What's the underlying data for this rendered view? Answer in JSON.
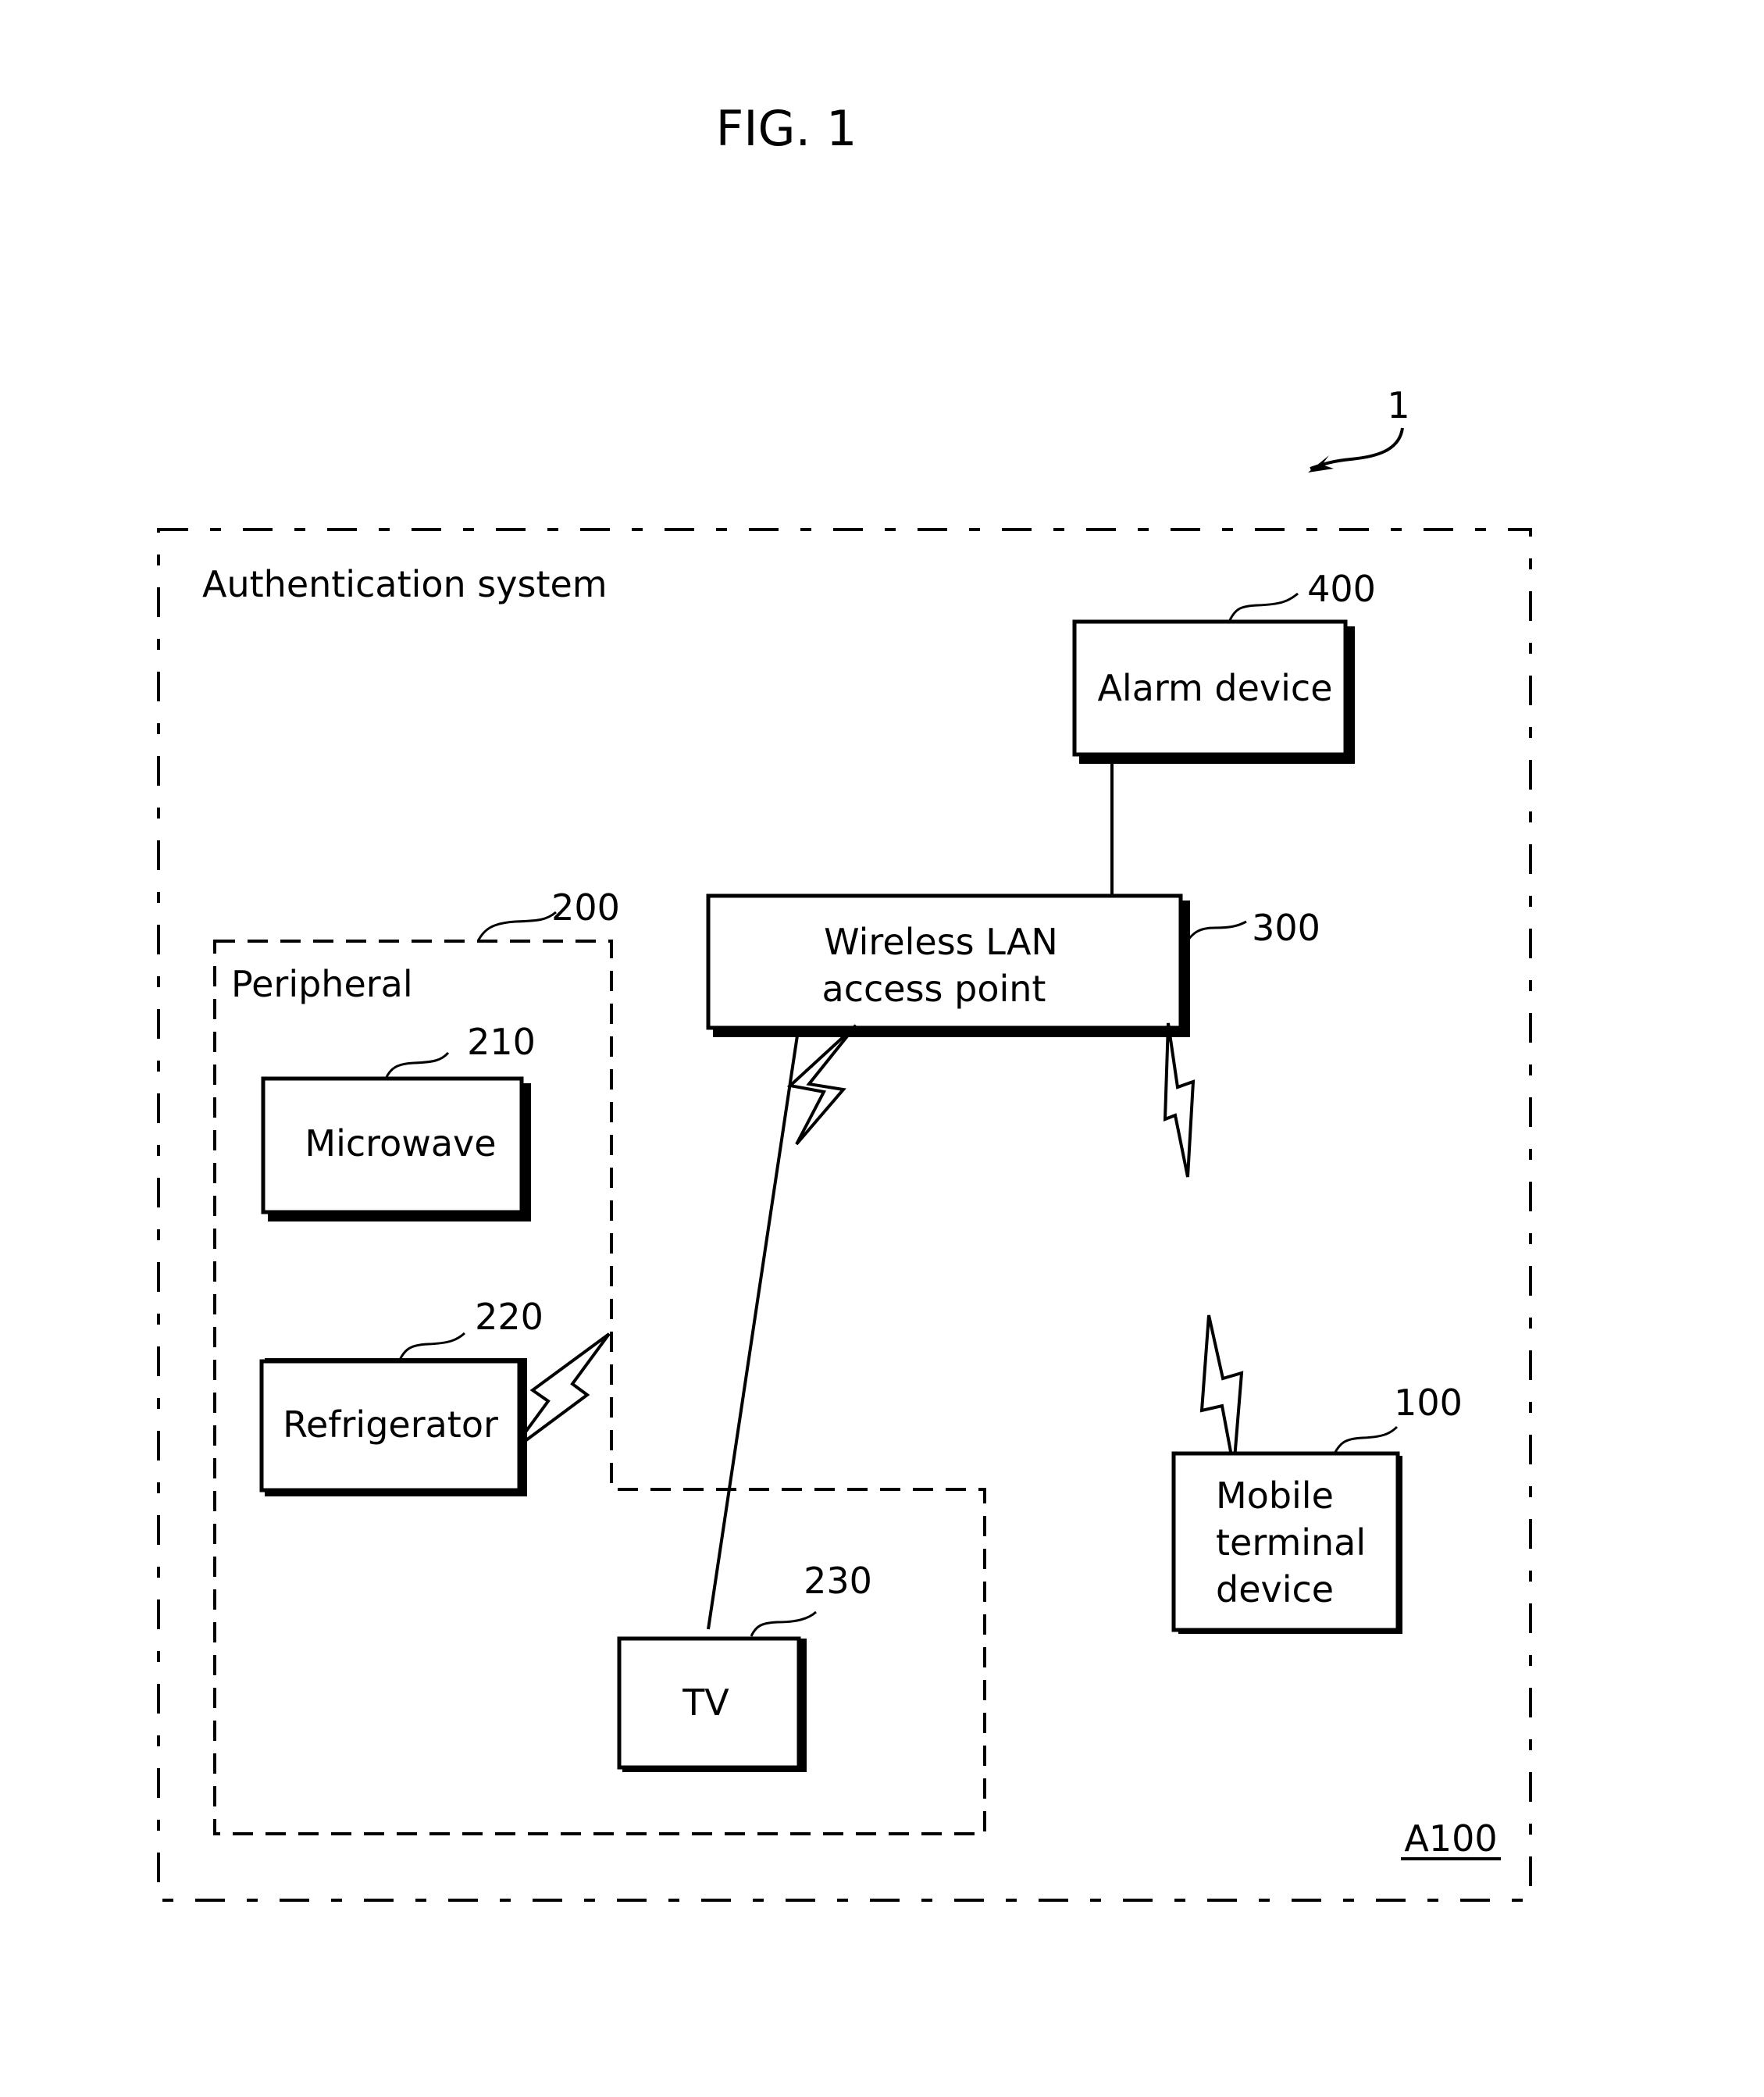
{
  "figure": {
    "title": "FIG. 1",
    "system_ref": "1",
    "area_ref": "A100",
    "colors": {
      "stroke": "#000000",
      "background": "#ffffff"
    }
  },
  "containers": {
    "system": {
      "label": "Authentication system"
    },
    "peripheral": {
      "label": "Peripheral",
      "ref": "200"
    }
  },
  "devices": {
    "alarm": {
      "lines": [
        "Alarm device"
      ],
      "ref": "400"
    },
    "wlan": {
      "lines": [
        "Wireless LAN",
        "access point"
      ],
      "ref": "300"
    },
    "microwave": {
      "lines": [
        "Microwave"
      ],
      "ref": "210"
    },
    "refrigerator": {
      "lines": [
        "Refrigerator"
      ],
      "ref": "220"
    },
    "tv": {
      "lines": [
        "TV"
      ],
      "ref": "230"
    },
    "mobile": {
      "lines": [
        "Mobile",
        "terminal",
        "device"
      ],
      "ref": "100"
    }
  },
  "connections": [
    {
      "from": "alarm",
      "to": "wlan",
      "type": "wired"
    },
    {
      "from": "tv",
      "to": "wlan",
      "type": "wired"
    },
    {
      "from": "wlan",
      "to": "peripheral",
      "type": "wireless"
    },
    {
      "from": "wlan",
      "to": "mobile",
      "type": "wireless"
    },
    {
      "from": "refrigerator",
      "to": "peripheral",
      "type": "wireless"
    }
  ]
}
